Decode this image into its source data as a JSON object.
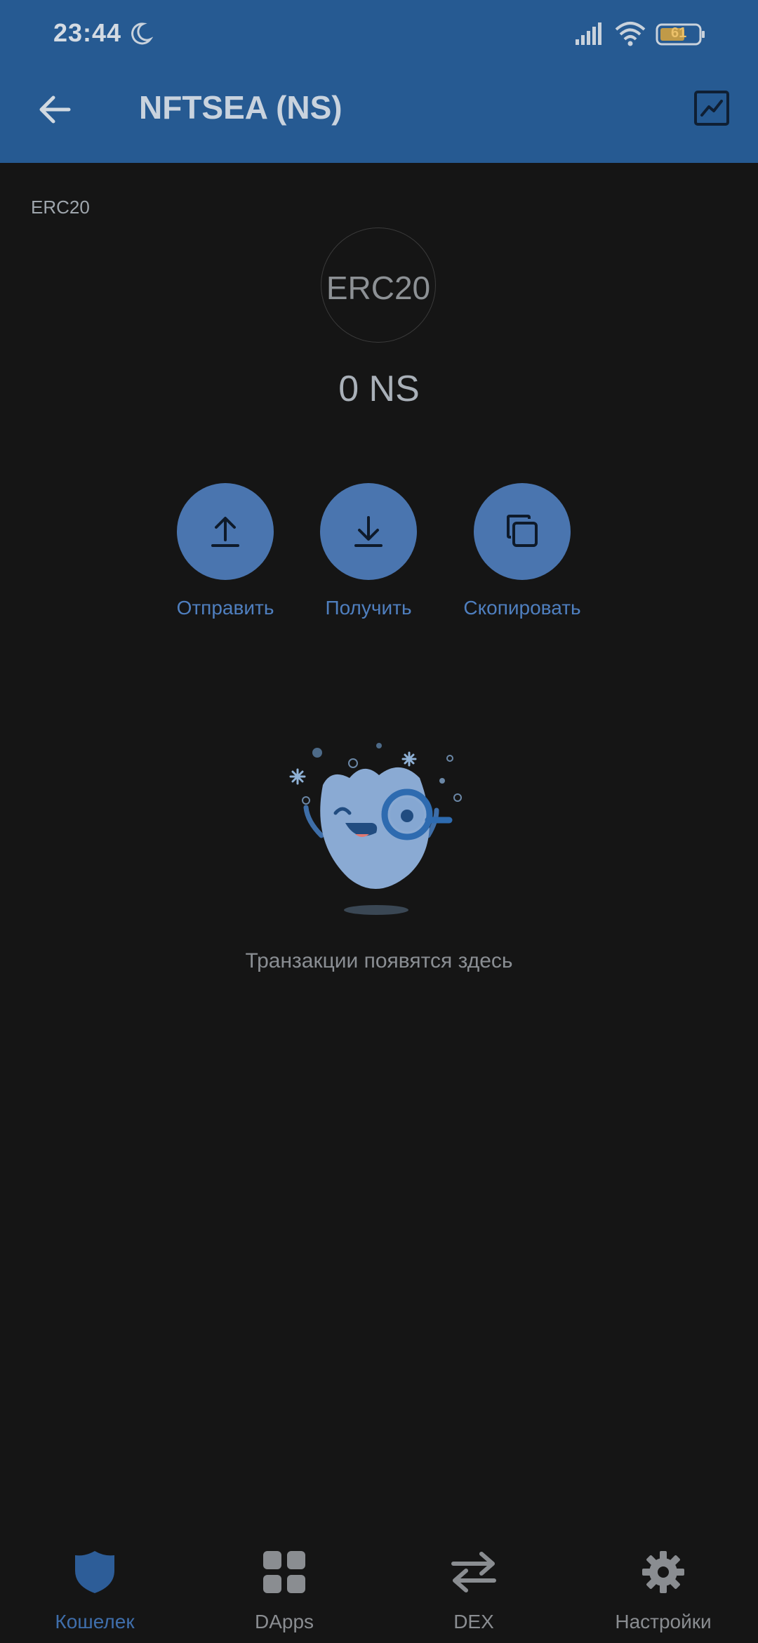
{
  "status_bar": {
    "time": "23:44",
    "battery": "61",
    "icons": [
      "moon-icon",
      "signal-icon",
      "wifi-icon",
      "battery-icon"
    ]
  },
  "header": {
    "title": "NFTSEA (NS)",
    "back_icon": "arrow-left-icon",
    "chart_icon": "chart-icon"
  },
  "token": {
    "network_tag": "ERC20",
    "logo_text": "ERC20",
    "balance": "0 NS"
  },
  "actions": [
    {
      "label": "Отправить",
      "icon": "upload-icon"
    },
    {
      "label": "Получить",
      "icon": "download-icon"
    },
    {
      "label": "Скопировать",
      "icon": "copy-icon"
    }
  ],
  "empty_state": {
    "message": "Транзакции появятся здесь",
    "illustration": "mascot-magnifier-illustration"
  },
  "bottom_nav": [
    {
      "label": "Кошелек",
      "icon": "shield-icon",
      "active": true
    },
    {
      "label": "DApps",
      "icon": "grid-icon",
      "active": false
    },
    {
      "label": "DEX",
      "icon": "swap-icon",
      "active": false
    },
    {
      "label": "Настройки",
      "icon": "gear-icon",
      "active": false
    }
  ],
  "colors": {
    "header_bg": "#265a92",
    "page_bg": "#151515",
    "accent": "#4a75af",
    "active_nav": "#3f6eab"
  }
}
